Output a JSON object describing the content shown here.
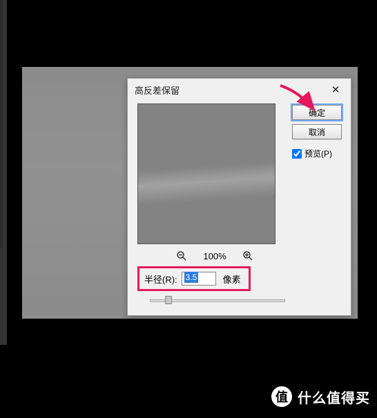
{
  "dialog": {
    "title": "高反差保留",
    "ok_label": "确定",
    "cancel_label": "取消",
    "preview_label": "预览(P)",
    "preview_checked": true,
    "zoom_level": "100%",
    "radius_label": "半径(R):",
    "radius_value": "3.5",
    "radius_unit": "像素"
  },
  "watermark": {
    "badge": "值",
    "text": "什么值得买"
  }
}
